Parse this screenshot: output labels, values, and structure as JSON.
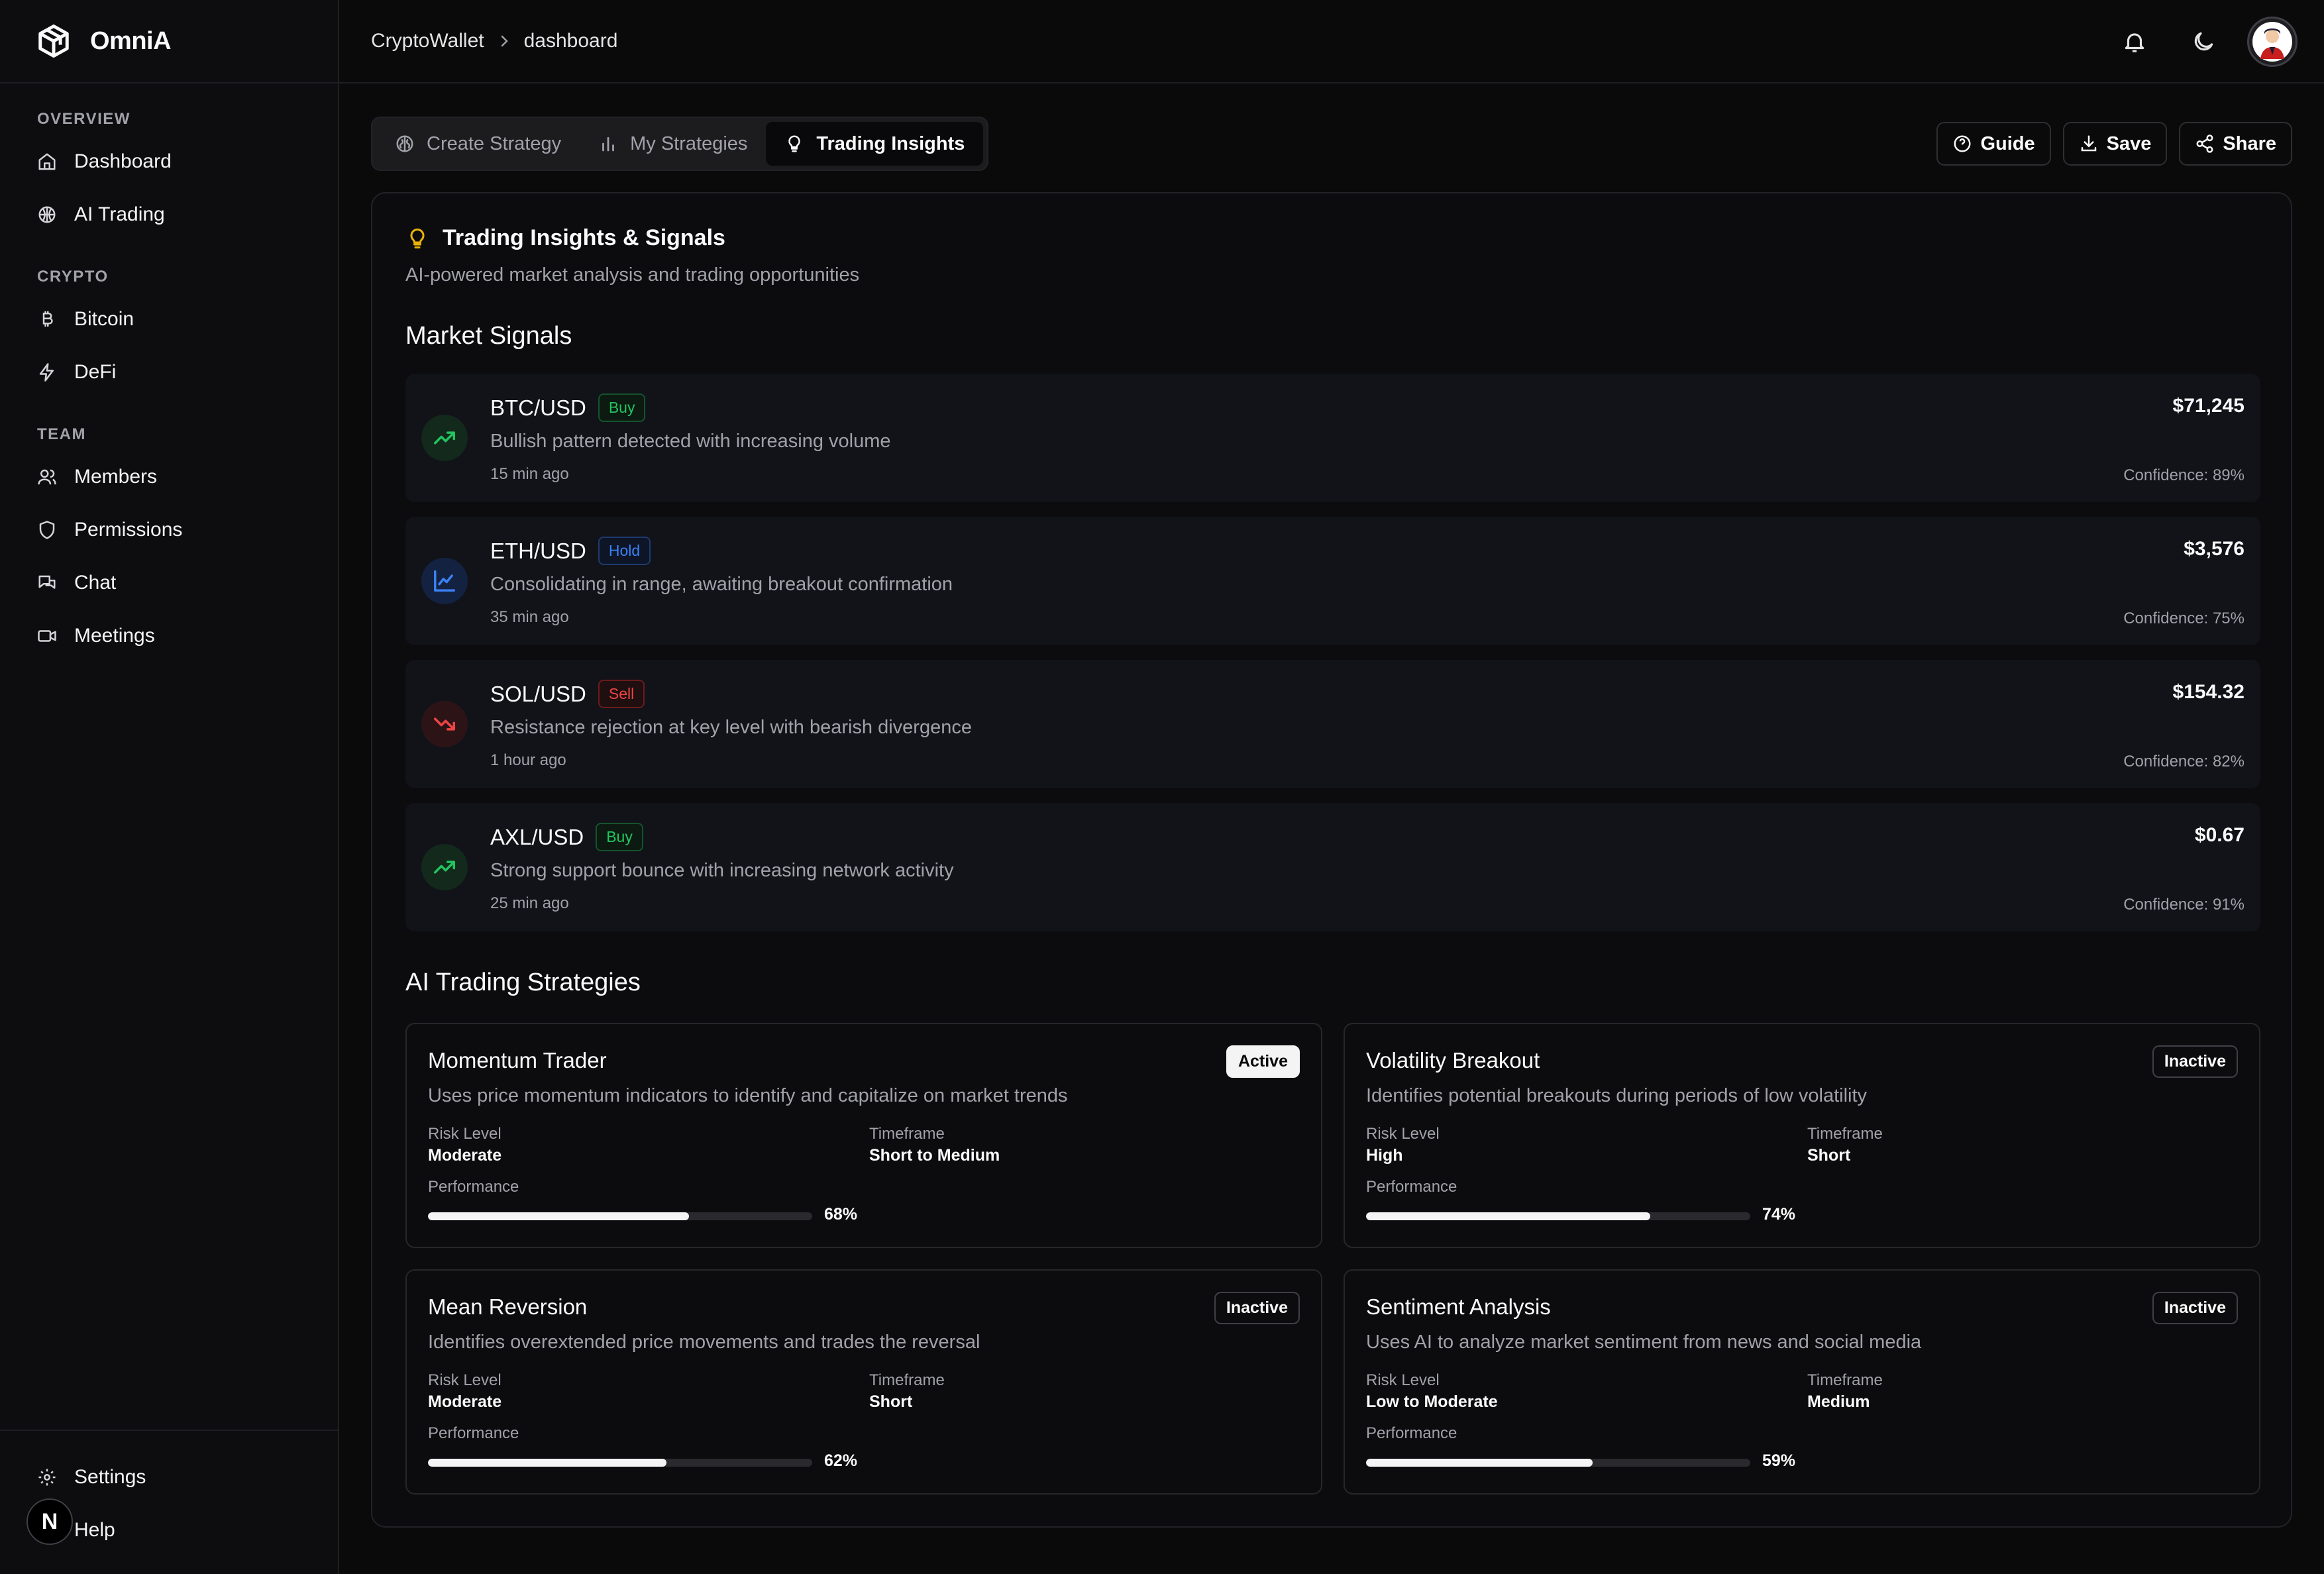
{
  "brand": {
    "name": "OmniA"
  },
  "sidebar": {
    "sections": [
      {
        "title": "OVERVIEW",
        "items": [
          {
            "label": "Dashboard",
            "icon": "home-icon"
          },
          {
            "label": "AI Trading",
            "icon": "globe-icon"
          }
        ]
      },
      {
        "title": "CRYPTO",
        "items": [
          {
            "label": "Bitcoin",
            "icon": "bitcoin-icon"
          },
          {
            "label": "DeFi",
            "icon": "zap-icon"
          }
        ]
      },
      {
        "title": "TEAM",
        "items": [
          {
            "label": "Members",
            "icon": "users-icon"
          },
          {
            "label": "Permissions",
            "icon": "shield-icon"
          },
          {
            "label": "Chat",
            "icon": "chat-icon"
          },
          {
            "label": "Meetings",
            "icon": "video-icon"
          }
        ]
      }
    ],
    "bottom": [
      {
        "label": "Settings",
        "icon": "gear-icon"
      },
      {
        "label": "Help",
        "icon": "help-icon"
      }
    ],
    "badge": "N"
  },
  "header": {
    "breadcrumb": [
      "CryptoWallet",
      "dashboard"
    ]
  },
  "tabs": [
    {
      "label": "Create Strategy",
      "icon": "brain-icon",
      "active": false
    },
    {
      "label": "My Strategies",
      "icon": "bar-chart-icon",
      "active": false
    },
    {
      "label": "Trading Insights",
      "icon": "lightbulb-icon",
      "active": true
    }
  ],
  "actions": {
    "guide": "Guide",
    "save": "Save",
    "share": "Share"
  },
  "insights": {
    "title": "Trading Insights & Signals",
    "subtitle": "AI-powered market analysis and trading opportunities",
    "signals_title": "Market Signals",
    "signals": [
      {
        "pair": "BTC/USD",
        "tag": "Buy",
        "desc": "Bullish pattern detected with increasing volume",
        "time": "15 min ago",
        "price": "$71,245",
        "confidence": "Confidence: 89%"
      },
      {
        "pair": "ETH/USD",
        "tag": "Hold",
        "desc": "Consolidating in range, awaiting breakout confirmation",
        "time": "35 min ago",
        "price": "$3,576",
        "confidence": "Confidence: 75%"
      },
      {
        "pair": "SOL/USD",
        "tag": "Sell",
        "desc": "Resistance rejection at key level with bearish divergence",
        "time": "1 hour ago",
        "price": "$154.32",
        "confidence": "Confidence: 82%"
      },
      {
        "pair": "AXL/USD",
        "tag": "Buy",
        "desc": "Strong support bounce with increasing network activity",
        "time": "25 min ago",
        "price": "$0.67",
        "confidence": "Confidence: 91%"
      }
    ],
    "strategies_title": "AI Trading Strategies",
    "risk_label": "Risk Level",
    "timeframe_label": "Timeframe",
    "performance_label": "Performance",
    "strategies": [
      {
        "name": "Momentum Trader",
        "status": "Active",
        "desc": "Uses price momentum indicators to identify and capitalize on market trends",
        "risk": "Moderate",
        "timeframe": "Short to Medium",
        "performance": 68,
        "performance_text": "68%"
      },
      {
        "name": "Volatility Breakout",
        "status": "Inactive",
        "desc": "Identifies potential breakouts during periods of low volatility",
        "risk": "High",
        "timeframe": "Short",
        "performance": 74,
        "performance_text": "74%"
      },
      {
        "name": "Mean Reversion",
        "status": "Inactive",
        "desc": "Identifies overextended price movements and trades the reversal",
        "risk": "Moderate",
        "timeframe": "Short",
        "performance": 62,
        "performance_text": "62%"
      },
      {
        "name": "Sentiment Analysis",
        "status": "Inactive",
        "desc": "Uses AI to analyze market sentiment from news and social media",
        "risk": "Low to Moderate",
        "timeframe": "Medium",
        "performance": 59,
        "performance_text": "59%"
      }
    ]
  },
  "colors": {
    "buy": "#22c55e",
    "hold": "#3b82f6",
    "sell": "#ef4444",
    "accent_bulb": "#eab308"
  }
}
